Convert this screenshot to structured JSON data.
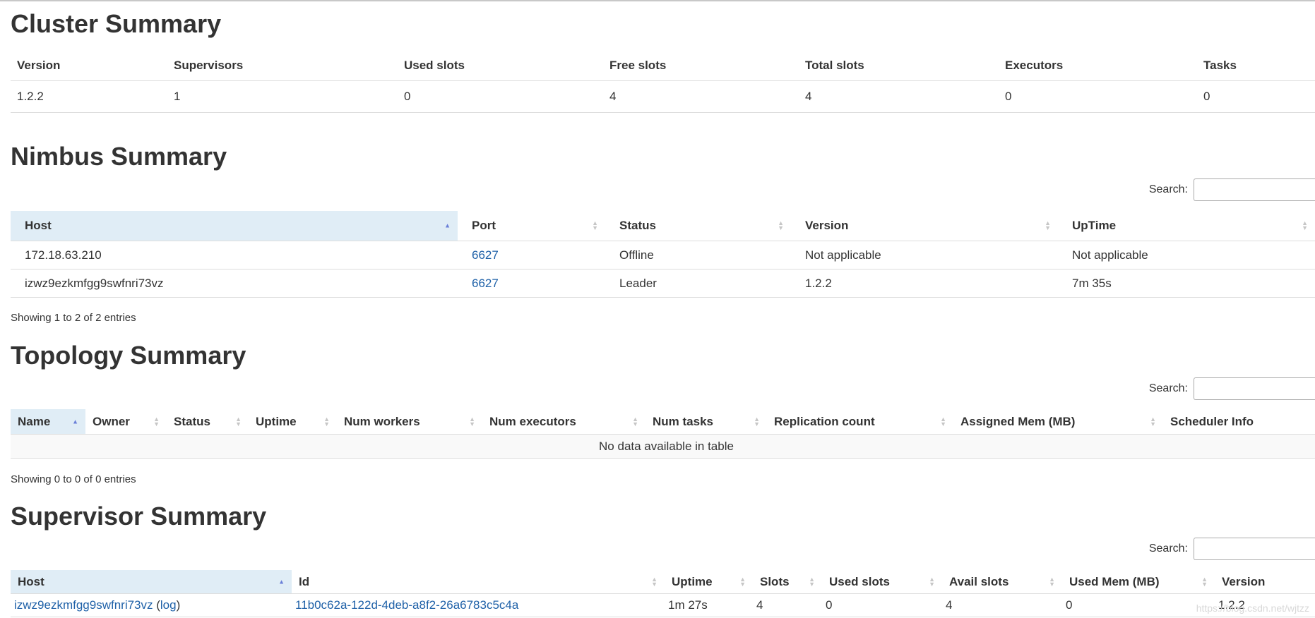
{
  "cluster": {
    "title": "Cluster Summary",
    "headers": [
      "Version",
      "Supervisors",
      "Used slots",
      "Free slots",
      "Total slots",
      "Executors",
      "Tasks"
    ],
    "row": [
      "1.2.2",
      "1",
      "0",
      "4",
      "4",
      "0",
      "0"
    ]
  },
  "nimbus": {
    "title": "Nimbus Summary",
    "search_label": "Search:",
    "headers": [
      "Host",
      "Port",
      "Status",
      "Version",
      "UpTime"
    ],
    "rows": [
      {
        "host": "172.18.63.210",
        "port": "6627",
        "status": "Offline",
        "version": "Not applicable",
        "uptime": "Not applicable"
      },
      {
        "host": "izwz9ezkmfgg9swfnri73vz",
        "port": "6627",
        "status": "Leader",
        "version": "1.2.2",
        "uptime": "7m 35s"
      }
    ],
    "info": "Showing 1 to 2 of 2 entries"
  },
  "topology": {
    "title": "Topology Summary",
    "search_label": "Search:",
    "headers": [
      "Name",
      "Owner",
      "Status",
      "Uptime",
      "Num workers",
      "Num executors",
      "Num tasks",
      "Replication count",
      "Assigned Mem (MB)",
      "Scheduler Info"
    ],
    "empty": "No data available in table",
    "info": "Showing 0 to 0 of 0 entries"
  },
  "supervisor": {
    "title": "Supervisor Summary",
    "search_label": "Search:",
    "headers": [
      "Host",
      "Id",
      "Uptime",
      "Slots",
      "Used slots",
      "Avail slots",
      "Used Mem (MB)",
      "Version"
    ],
    "row": {
      "host": "izwz9ezkmfgg9swfnri73vz",
      "log_open": " (",
      "log": "log",
      "log_close": ")",
      "id": "11b0c62a-122d-4deb-a8f2-26a6783c5c4a",
      "uptime": "1m 27s",
      "slots": "4",
      "used_slots": "0",
      "avail_slots": "4",
      "used_mem": "0",
      "version": "1.2.2"
    }
  },
  "watermark": "https://blog.csdn.net/wjtzz",
  "colors": {
    "link": "#1f61a8",
    "active_header": "#e0edf6",
    "sort_active": "#6a7fd8"
  }
}
